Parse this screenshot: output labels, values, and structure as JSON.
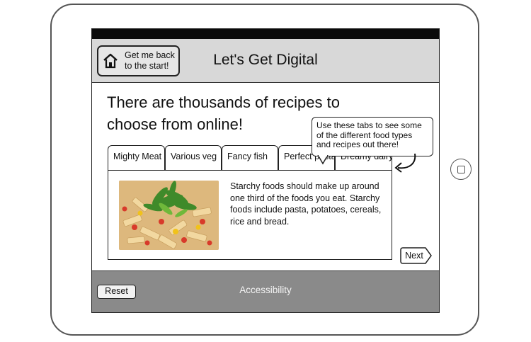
{
  "header": {
    "start_button_label": "Get me back\nto the start!",
    "title": "Let's Get Digital"
  },
  "main": {
    "headline": "There are thousands of recipes to choose from online!",
    "tabs": [
      {
        "label": "Mighty Meat"
      },
      {
        "label": "Various veg"
      },
      {
        "label": "Fancy fish"
      },
      {
        "label": "Perfect pasta"
      },
      {
        "label": "Dreamy dairy"
      }
    ],
    "active_tab": "Perfect pasta",
    "description": "Starchy foods should make up around one third of the foods you eat. Starchy foods include pasta, potatoes, cereals, rice and bread.",
    "callout": "Use these tabs to see some of the different food types and recipes out there!",
    "next_label": "Next"
  },
  "footer": {
    "reset_label": "Reset",
    "accessibility_label": "Accessibility"
  },
  "icons": [
    "house-icon",
    "curved-arrow-icon",
    "device-home-button"
  ],
  "colors": {
    "header_bg": "#d8d8d8",
    "footer_bg": "#8a8a8a",
    "status_bar": "#0a0a0a"
  }
}
